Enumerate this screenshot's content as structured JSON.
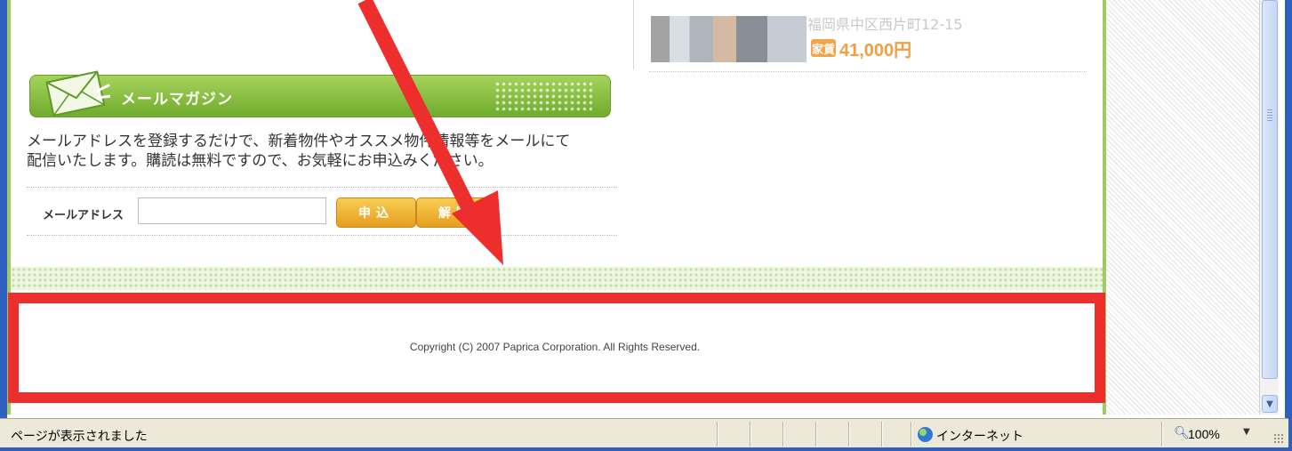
{
  "property": {
    "address": "福岡県中区西片町12-15",
    "rent_badge": "家賃",
    "rent_price": "41,000円"
  },
  "mail_magazine": {
    "title": "メールマガジン",
    "description_line1": "メールアドレスを登録するだけで、新着物件やオススメ物件情報等をメールにて",
    "description_line2": "配信いたします。購読は無料ですので、お気軽にお申込みください。",
    "email_label": "メールアドレス",
    "email_value": "",
    "subscribe_label": "申込",
    "cancel_label": "解除"
  },
  "footer": {
    "copyright": "Copyright (C) 2007 Paprica Corporation. All Rights Reserved."
  },
  "status_bar": {
    "status_text": "ページが表示されました",
    "zone_label": "インターネット",
    "zoom_label": "100%"
  },
  "colors": {
    "highlight": "#ee2d2d",
    "arrow": "#ee2d2d",
    "header_green": "#7fb83a",
    "button_orange": "#eeae33"
  },
  "icons": {
    "envelope": "envelope-icon",
    "internet": "globe-icon",
    "zoom": "magnifier-icon"
  }
}
